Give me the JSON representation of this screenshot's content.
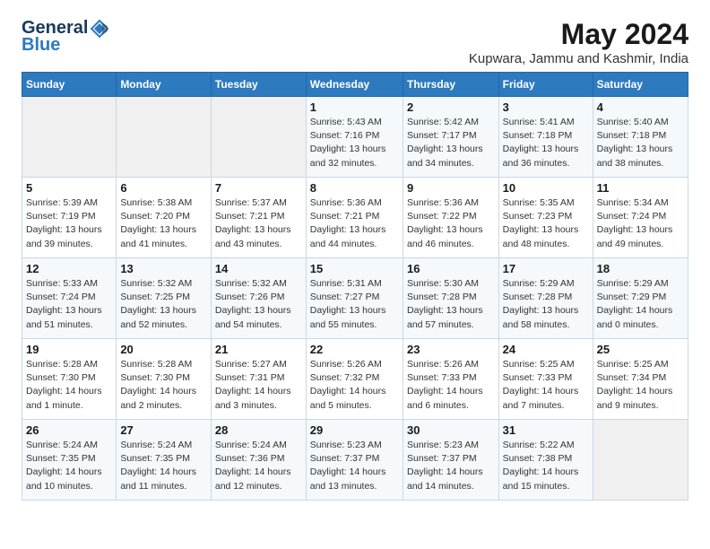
{
  "header": {
    "logo_general": "General",
    "logo_blue": "Blue",
    "month_year": "May 2024",
    "location": "Kupwara, Jammu and Kashmir, India"
  },
  "days_of_week": [
    "Sunday",
    "Monday",
    "Tuesday",
    "Wednesday",
    "Thursday",
    "Friday",
    "Saturday"
  ],
  "weeks": [
    [
      {
        "day": "",
        "sunrise": "",
        "sunset": "",
        "daylight": ""
      },
      {
        "day": "",
        "sunrise": "",
        "sunset": "",
        "daylight": ""
      },
      {
        "day": "",
        "sunrise": "",
        "sunset": "",
        "daylight": ""
      },
      {
        "day": "1",
        "sunrise": "Sunrise: 5:43 AM",
        "sunset": "Sunset: 7:16 PM",
        "daylight": "Daylight: 13 hours and 32 minutes."
      },
      {
        "day": "2",
        "sunrise": "Sunrise: 5:42 AM",
        "sunset": "Sunset: 7:17 PM",
        "daylight": "Daylight: 13 hours and 34 minutes."
      },
      {
        "day": "3",
        "sunrise": "Sunrise: 5:41 AM",
        "sunset": "Sunset: 7:18 PM",
        "daylight": "Daylight: 13 hours and 36 minutes."
      },
      {
        "day": "4",
        "sunrise": "Sunrise: 5:40 AM",
        "sunset": "Sunset: 7:18 PM",
        "daylight": "Daylight: 13 hours and 38 minutes."
      }
    ],
    [
      {
        "day": "5",
        "sunrise": "Sunrise: 5:39 AM",
        "sunset": "Sunset: 7:19 PM",
        "daylight": "Daylight: 13 hours and 39 minutes."
      },
      {
        "day": "6",
        "sunrise": "Sunrise: 5:38 AM",
        "sunset": "Sunset: 7:20 PM",
        "daylight": "Daylight: 13 hours and 41 minutes."
      },
      {
        "day": "7",
        "sunrise": "Sunrise: 5:37 AM",
        "sunset": "Sunset: 7:21 PM",
        "daylight": "Daylight: 13 hours and 43 minutes."
      },
      {
        "day": "8",
        "sunrise": "Sunrise: 5:36 AM",
        "sunset": "Sunset: 7:21 PM",
        "daylight": "Daylight: 13 hours and 44 minutes."
      },
      {
        "day": "9",
        "sunrise": "Sunrise: 5:36 AM",
        "sunset": "Sunset: 7:22 PM",
        "daylight": "Daylight: 13 hours and 46 minutes."
      },
      {
        "day": "10",
        "sunrise": "Sunrise: 5:35 AM",
        "sunset": "Sunset: 7:23 PM",
        "daylight": "Daylight: 13 hours and 48 minutes."
      },
      {
        "day": "11",
        "sunrise": "Sunrise: 5:34 AM",
        "sunset": "Sunset: 7:24 PM",
        "daylight": "Daylight: 13 hours and 49 minutes."
      }
    ],
    [
      {
        "day": "12",
        "sunrise": "Sunrise: 5:33 AM",
        "sunset": "Sunset: 7:24 PM",
        "daylight": "Daylight: 13 hours and 51 minutes."
      },
      {
        "day": "13",
        "sunrise": "Sunrise: 5:32 AM",
        "sunset": "Sunset: 7:25 PM",
        "daylight": "Daylight: 13 hours and 52 minutes."
      },
      {
        "day": "14",
        "sunrise": "Sunrise: 5:32 AM",
        "sunset": "Sunset: 7:26 PM",
        "daylight": "Daylight: 13 hours and 54 minutes."
      },
      {
        "day": "15",
        "sunrise": "Sunrise: 5:31 AM",
        "sunset": "Sunset: 7:27 PM",
        "daylight": "Daylight: 13 hours and 55 minutes."
      },
      {
        "day": "16",
        "sunrise": "Sunrise: 5:30 AM",
        "sunset": "Sunset: 7:28 PM",
        "daylight": "Daylight: 13 hours and 57 minutes."
      },
      {
        "day": "17",
        "sunrise": "Sunrise: 5:29 AM",
        "sunset": "Sunset: 7:28 PM",
        "daylight": "Daylight: 13 hours and 58 minutes."
      },
      {
        "day": "18",
        "sunrise": "Sunrise: 5:29 AM",
        "sunset": "Sunset: 7:29 PM",
        "daylight": "Daylight: 14 hours and 0 minutes."
      }
    ],
    [
      {
        "day": "19",
        "sunrise": "Sunrise: 5:28 AM",
        "sunset": "Sunset: 7:30 PM",
        "daylight": "Daylight: 14 hours and 1 minute."
      },
      {
        "day": "20",
        "sunrise": "Sunrise: 5:28 AM",
        "sunset": "Sunset: 7:30 PM",
        "daylight": "Daylight: 14 hours and 2 minutes."
      },
      {
        "day": "21",
        "sunrise": "Sunrise: 5:27 AM",
        "sunset": "Sunset: 7:31 PM",
        "daylight": "Daylight: 14 hours and 3 minutes."
      },
      {
        "day": "22",
        "sunrise": "Sunrise: 5:26 AM",
        "sunset": "Sunset: 7:32 PM",
        "daylight": "Daylight: 14 hours and 5 minutes."
      },
      {
        "day": "23",
        "sunrise": "Sunrise: 5:26 AM",
        "sunset": "Sunset: 7:33 PM",
        "daylight": "Daylight: 14 hours and 6 minutes."
      },
      {
        "day": "24",
        "sunrise": "Sunrise: 5:25 AM",
        "sunset": "Sunset: 7:33 PM",
        "daylight": "Daylight: 14 hours and 7 minutes."
      },
      {
        "day": "25",
        "sunrise": "Sunrise: 5:25 AM",
        "sunset": "Sunset: 7:34 PM",
        "daylight": "Daylight: 14 hours and 9 minutes."
      }
    ],
    [
      {
        "day": "26",
        "sunrise": "Sunrise: 5:24 AM",
        "sunset": "Sunset: 7:35 PM",
        "daylight": "Daylight: 14 hours and 10 minutes."
      },
      {
        "day": "27",
        "sunrise": "Sunrise: 5:24 AM",
        "sunset": "Sunset: 7:35 PM",
        "daylight": "Daylight: 14 hours and 11 minutes."
      },
      {
        "day": "28",
        "sunrise": "Sunrise: 5:24 AM",
        "sunset": "Sunset: 7:36 PM",
        "daylight": "Daylight: 14 hours and 12 minutes."
      },
      {
        "day": "29",
        "sunrise": "Sunrise: 5:23 AM",
        "sunset": "Sunset: 7:37 PM",
        "daylight": "Daylight: 14 hours and 13 minutes."
      },
      {
        "day": "30",
        "sunrise": "Sunrise: 5:23 AM",
        "sunset": "Sunset: 7:37 PM",
        "daylight": "Daylight: 14 hours and 14 minutes."
      },
      {
        "day": "31",
        "sunrise": "Sunrise: 5:22 AM",
        "sunset": "Sunset: 7:38 PM",
        "daylight": "Daylight: 14 hours and 15 minutes."
      },
      {
        "day": "",
        "sunrise": "",
        "sunset": "",
        "daylight": ""
      }
    ]
  ]
}
